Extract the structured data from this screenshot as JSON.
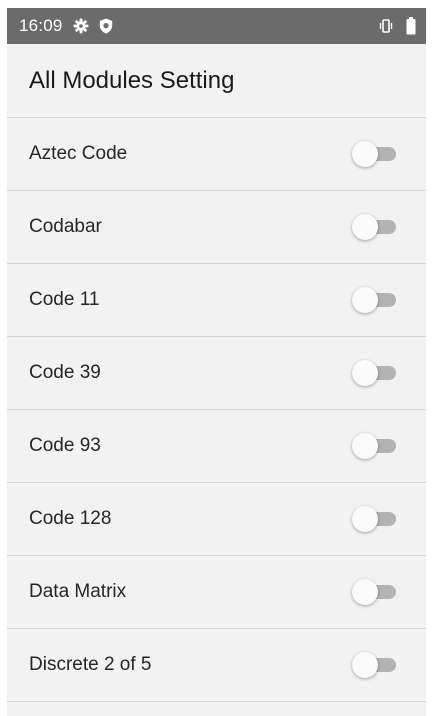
{
  "status_bar": {
    "time": "16:09",
    "icons_left": [
      "gear-icon",
      "shield-icon"
    ],
    "icons_right": [
      "vibrate-icon",
      "battery-icon"
    ]
  },
  "app_bar": {
    "title": "All Modules Setting"
  },
  "modules": [
    {
      "label": "Aztec Code",
      "enabled": false
    },
    {
      "label": "Codabar",
      "enabled": false
    },
    {
      "label": "Code 11",
      "enabled": false
    },
    {
      "label": "Code 39",
      "enabled": false
    },
    {
      "label": "Code 93",
      "enabled": false
    },
    {
      "label": "Code 128",
      "enabled": false
    },
    {
      "label": "Data Matrix",
      "enabled": false
    },
    {
      "label": "Discrete 2 of 5",
      "enabled": false
    }
  ],
  "colors": {
    "status_bar": "#6b6b6b",
    "background": "#f2f2f2",
    "switch_track_off": "#b3b3b3",
    "switch_thumb_off": "#fafafa"
  }
}
